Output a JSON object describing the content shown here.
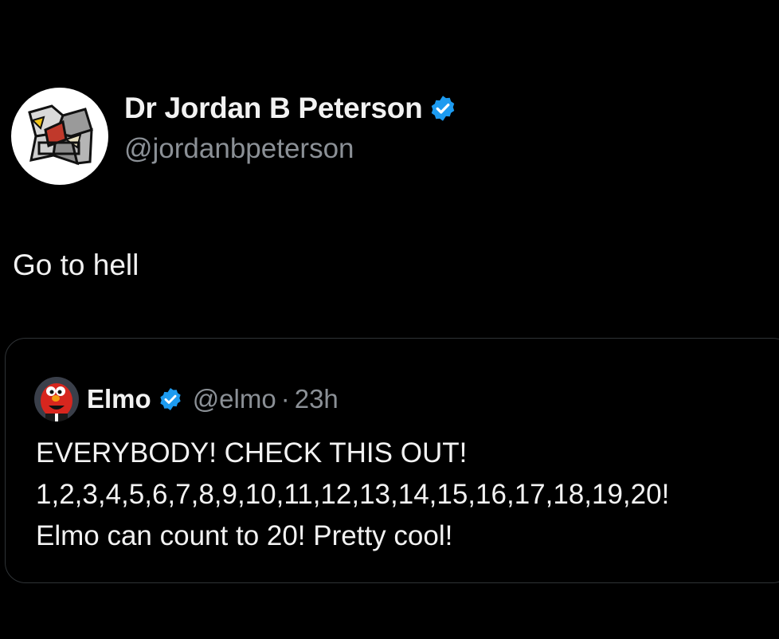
{
  "tweet": {
    "author": {
      "display_name": "Dr Jordan B Peterson",
      "handle": "@jordanbpeterson",
      "verified": true,
      "avatar_icon": "cubist-self-portrait-avatar"
    },
    "text": "Go to hell"
  },
  "quoted_tweet": {
    "author": {
      "display_name": "Elmo",
      "handle": "@elmo",
      "verified": true,
      "avatar_icon": "elmo-avatar"
    },
    "separator": "·",
    "time": "23h",
    "lines": [
      "EVERYBODY! CHECK THIS OUT!",
      "1,2,3,4,5,6,7,8,9,10,11,12,13,14,15,16,17,18,19,20!",
      "Elmo can count to 20! Pretty cool!"
    ]
  },
  "colors": {
    "background": "#000000",
    "text_primary": "#f2f2f2",
    "text_secondary": "#8b9096",
    "verified_blue": "#1d9bf0",
    "border": "#2f3336"
  }
}
